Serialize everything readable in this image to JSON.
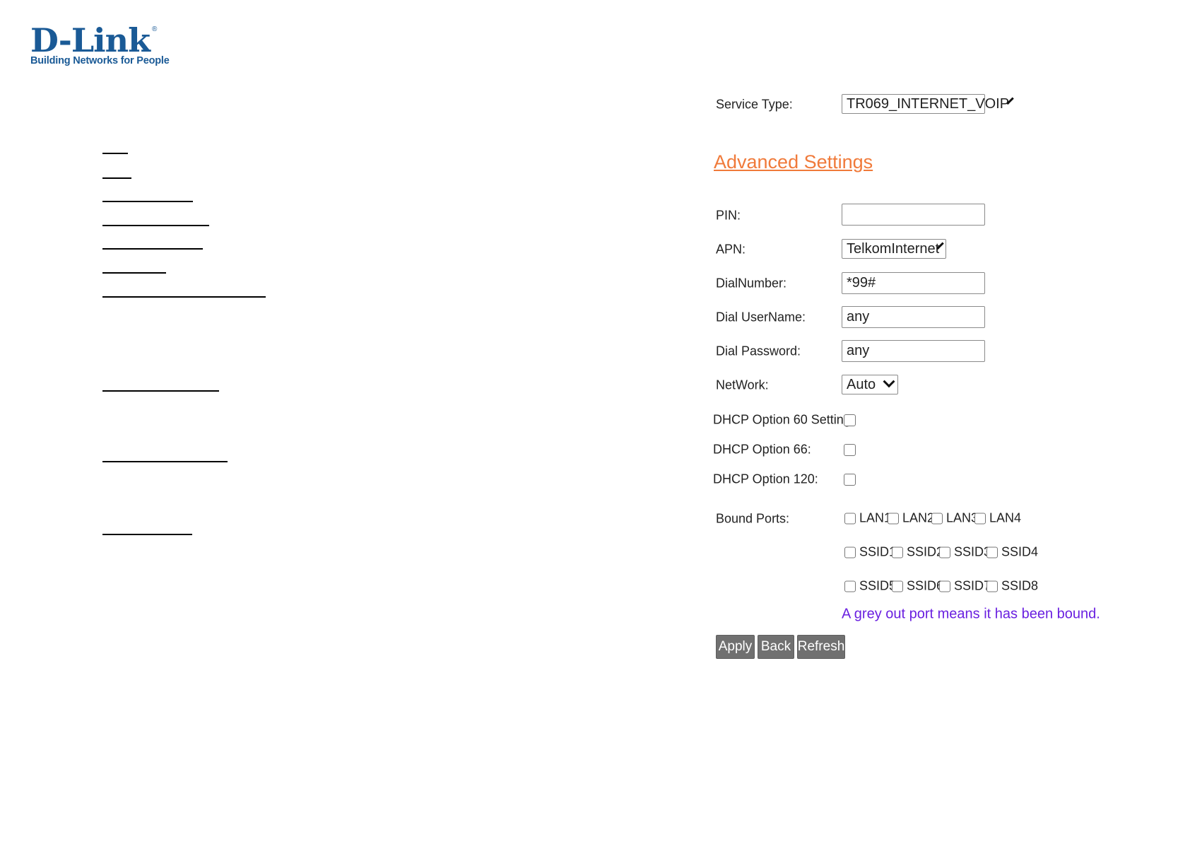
{
  "logo": {
    "brand": "D-Link",
    "tagline": "Building Networks for People",
    "registered": "®"
  },
  "form": {
    "service_type": {
      "label": "Service Type:",
      "value": "TR069_INTERNET_VOIP"
    },
    "advanced_settings": "Advanced Settings",
    "pin": {
      "label": "PIN:",
      "value": ""
    },
    "apn": {
      "label": "APN:",
      "value": "TelkomInternet"
    },
    "dial_number": {
      "label": "DialNumber:",
      "value": "*99#"
    },
    "dial_username": {
      "label": "Dial UserName:",
      "value": "any"
    },
    "dial_password": {
      "label": "Dial Password:",
      "value": "any"
    },
    "network": {
      "label": "NetWork:",
      "value": "Auto"
    },
    "dhcp60": {
      "label": "DHCP Option 60 Setting:",
      "checked": false
    },
    "dhcp66": {
      "label": "DHCP Option 66:",
      "checked": false
    },
    "dhcp120": {
      "label": "DHCP Option 120:",
      "checked": false
    },
    "bound_ports": {
      "label": "Bound Ports:",
      "ports": [
        "LAN1",
        "LAN2",
        "LAN3",
        "LAN4",
        "SSID1",
        "SSID2",
        "SSID3",
        "SSID4",
        "SSID5",
        "SSID6",
        "SSID7",
        "SSID8"
      ]
    },
    "note": "A grey out port means it has been bound."
  },
  "buttons": {
    "apply": "Apply",
    "back": "Back",
    "refresh": "Refresh"
  },
  "colors": {
    "brand": "#1a5a96",
    "advanced_link": "#f07a3a",
    "note": "#6a20e0",
    "button": "#707070"
  }
}
